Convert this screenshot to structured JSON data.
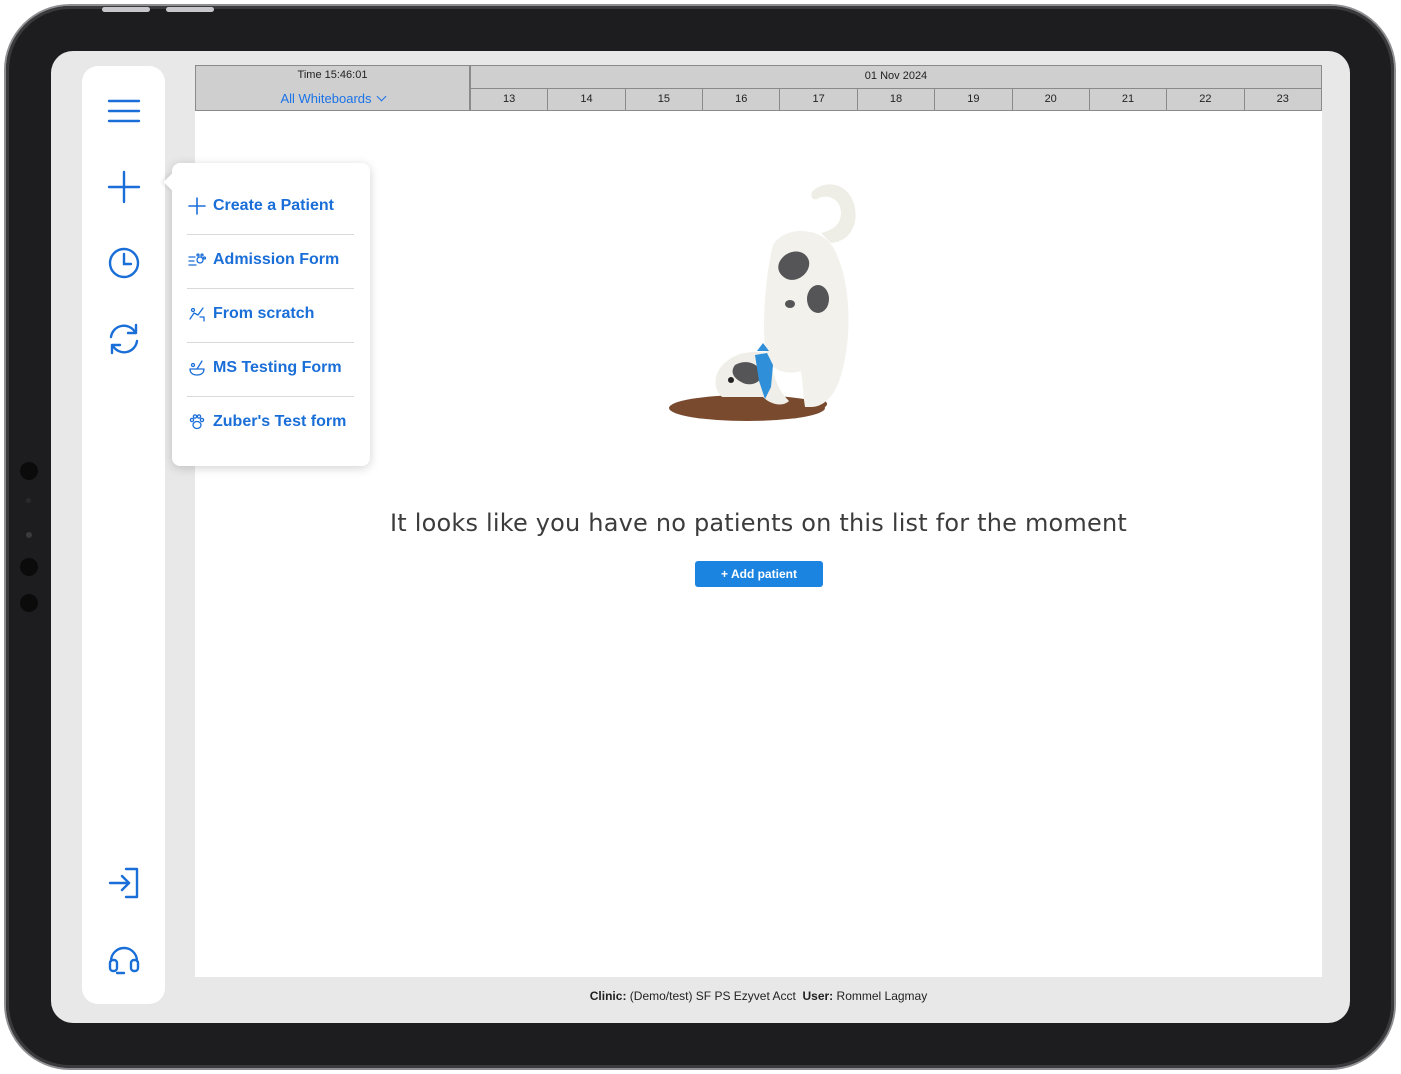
{
  "timeline": {
    "time_label": "Time 15:46:01",
    "whiteboard_selector": "All Whiteboards",
    "date": "01 Nov 2024",
    "hours": [
      "13",
      "14",
      "15",
      "16",
      "17",
      "18",
      "19",
      "20",
      "21",
      "22",
      "23"
    ]
  },
  "sidebar": {
    "icons": [
      "menu-icon",
      "plus-icon",
      "clock-icon",
      "refresh-icon",
      "login-icon",
      "headset-icon"
    ]
  },
  "create_menu": {
    "items": [
      {
        "label": "Create a Patient",
        "icon": "plus-icon"
      },
      {
        "label": "Admission Form",
        "icon": "admission-form-icon"
      },
      {
        "label": "From scratch",
        "icon": "from-scratch-icon"
      },
      {
        "label": "MS Testing Form",
        "icon": "ms-testing-form-icon"
      },
      {
        "label": "Zuber's Test form",
        "icon": "paw-icon"
      }
    ]
  },
  "empty_state": {
    "message": "It looks like you have no patients on this list for the moment",
    "button_label": "+ Add patient",
    "illustration": "dog-digging-illustration"
  },
  "footer": {
    "clinic_label": "Clinic:",
    "clinic_value": "(Demo/test) SF PS Ezyvet Acct",
    "user_label": "User:",
    "user_value": "Rommel Lagmay"
  },
  "colors": {
    "accent": "#1a73e8",
    "button": "#1a84e0",
    "timeline_bg": "#cfcfcf",
    "device_frame": "#1d1d1f"
  }
}
